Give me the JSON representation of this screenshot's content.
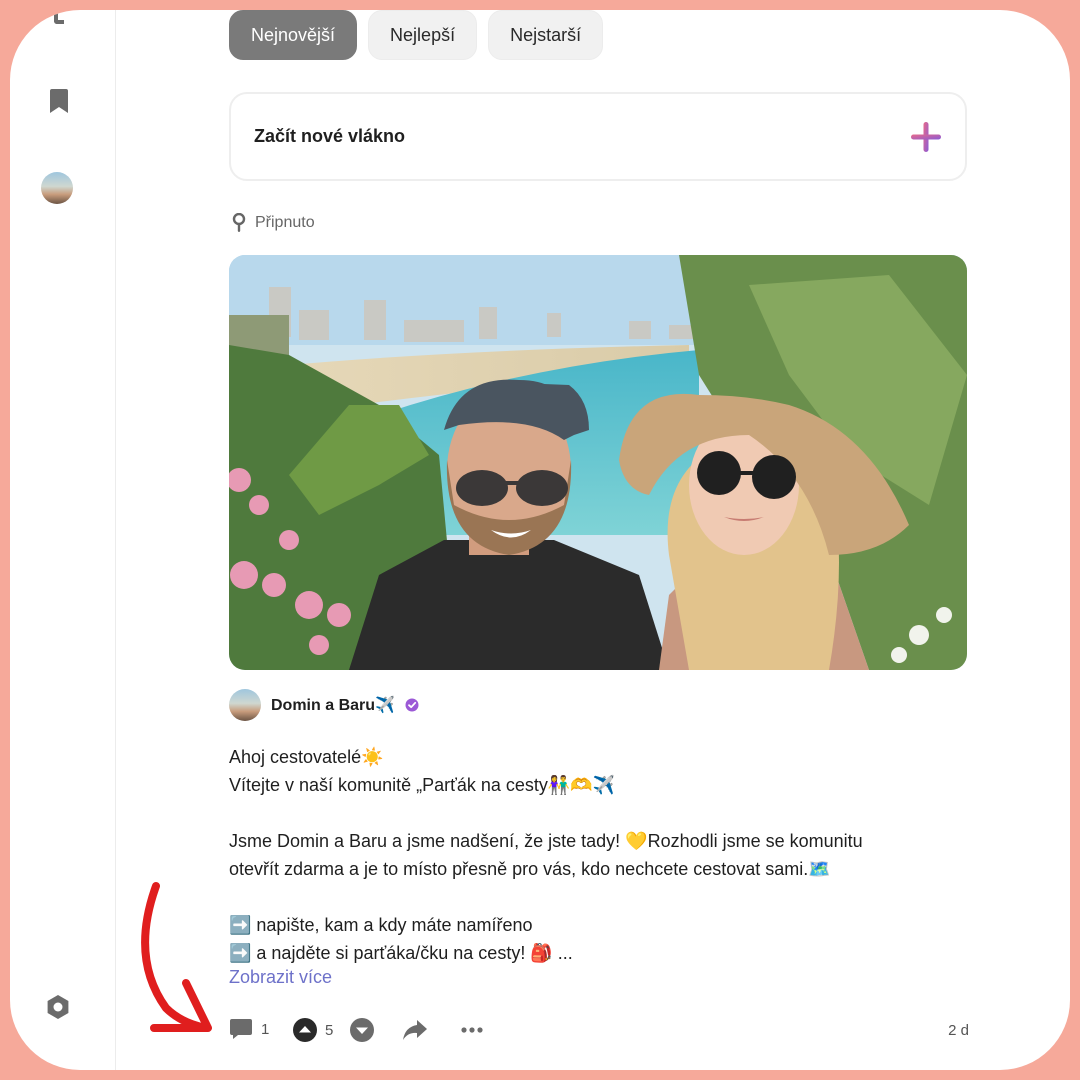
{
  "tabs": [
    {
      "label": "Nejnovější",
      "active": true
    },
    {
      "label": "Nejlepší",
      "active": false
    },
    {
      "label": "Nejstarší",
      "active": false
    }
  ],
  "new_thread": {
    "label": "Začít nové vlákno",
    "icon": "plus-icon"
  },
  "pinned": {
    "label": "Připnuto",
    "icon": "pin-icon"
  },
  "post": {
    "image_alt": "beach-selfie-photo",
    "author": "Domin a Baru✈️",
    "body": [
      "Ahoj cestovatelé☀️",
      "Vítejte v naší komunitě „Parťák na cesty👫🫶✈️",
      "",
      "Jsme Domin a Baru a jsme nadšení, že jste tady! 💛Rozhodli jsme se komunitu",
      "otevřít zdarma a je to místo přesně pro vás, kdo nechcete cestovat sami.🗺️",
      "",
      "➡️ napište, kam a kdy máte namířeno",
      "➡️ a najděte si parťáka/čku na cesty! 🎒 ..."
    ],
    "show_more": "Zobrazit více",
    "comments": "1",
    "votes": "5",
    "time": "2 d"
  },
  "colors": {
    "frame": "#f6a99a",
    "active_tab": "#7a7a7a",
    "link": "#6d71c9",
    "plus_gradient_start": "#e86a8a",
    "plus_gradient_end": "#8a5bd6",
    "verified": "#9b59d6",
    "arrow": "#e01e1e"
  }
}
